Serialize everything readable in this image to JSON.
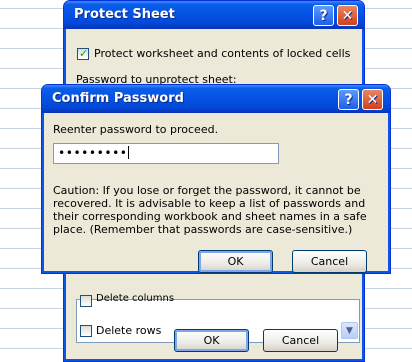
{
  "protect_sheet": {
    "title": "Protect Sheet",
    "protect_checkbox_label": "Protect worksheet and contents of locked cells",
    "protect_checkbox_mnemonic": "c",
    "password_label_partial": "Password to unprotect sheet:",
    "list_item_partial": "Delete columns",
    "list_item": "Delete rows",
    "ok_label": "OK",
    "cancel_label": "Cancel"
  },
  "confirm_password": {
    "title": "Confirm Password",
    "prompt": "Reenter password to proceed.",
    "password_mask": "•••••••••",
    "caution": "Caution: If you lose or forget the password, it cannot be recovered. It is advisable to keep a list of passwords and their corresponding workbook and sheet names in a safe place.  (Remember that passwords are case-sensitive.)",
    "ok_label": "OK",
    "cancel_label": "Cancel"
  },
  "titlebar": {
    "help_glyph": "?",
    "close_glyph": "✕"
  },
  "colors": {
    "titlebar": "#0553e6",
    "dialog_face": "#ece9d8",
    "close": "#d2411c"
  }
}
